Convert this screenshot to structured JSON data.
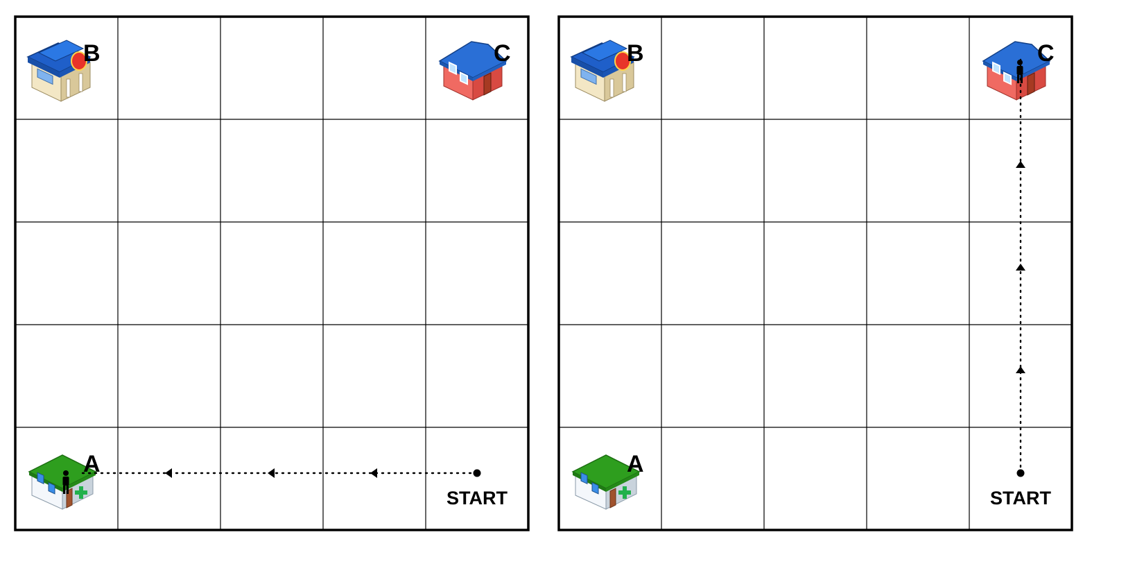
{
  "grid": {
    "rows": 5,
    "cols": 5
  },
  "colors": {
    "grid_line": "#000000",
    "path": "#000000",
    "pharmacy_roof": "#2e9e1e",
    "pharmacy_cross": "#22b14c",
    "shop_roof": "#1f5fc9",
    "house_wall": "#e0554f",
    "house_roof": "#2a6fd6"
  },
  "places": {
    "A": {
      "label": "A",
      "kind": "pharmacy",
      "row": 4,
      "col": 0
    },
    "B": {
      "label": "B",
      "kind": "shop",
      "row": 0,
      "col": 0
    },
    "C": {
      "label": "C",
      "kind": "house",
      "row": 0,
      "col": 4
    }
  },
  "start": {
    "label": "START",
    "row": 4,
    "col": 4
  },
  "panels": [
    {
      "id": "left",
      "route": {
        "direction": "west",
        "steps": 4,
        "destination": "A"
      }
    },
    {
      "id": "right",
      "route": {
        "direction": "north",
        "steps": 4,
        "destination": "C"
      }
    }
  ]
}
